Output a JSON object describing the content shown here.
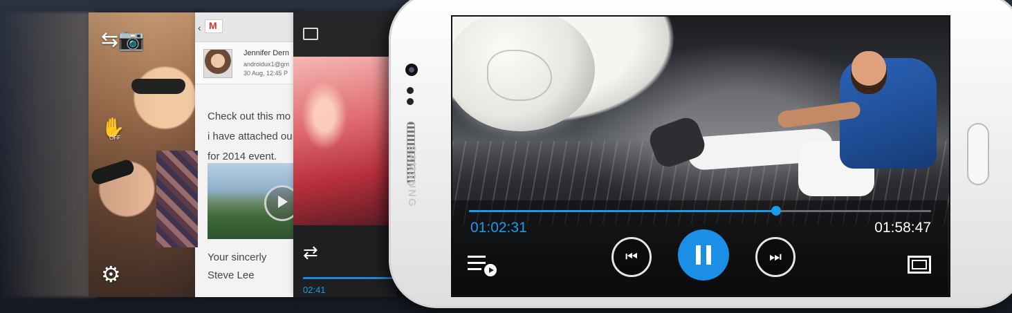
{
  "gallery_panel": {
    "hand_label": "OFF",
    "icons": [
      "camera-switch-icon",
      "hand-off-icon",
      "gear-icon"
    ]
  },
  "email_panel": {
    "sender_name": "Jennifer Dern",
    "sender_address": "androidux1@gm",
    "date": "30 Aug, 12:45 P",
    "body_lines": [
      "Check out this mo",
      "i have attached ou",
      "for 2014 event."
    ],
    "signature_lines": [
      "Your sincerly",
      "Steve Lee"
    ]
  },
  "music_panel": {
    "elapsed": "02:41",
    "icons": [
      "cast-icon",
      "shuffle-icon"
    ]
  },
  "phone": {
    "brand": "SAMSUNG"
  },
  "video_player": {
    "current_time": "01:02:31",
    "total_time": "01:58:47",
    "progress": 0.665,
    "accent_color": "#1a9be8",
    "icons": [
      "previous-icon",
      "pause-icon",
      "next-icon",
      "playlist-icon",
      "fullscreen-icon"
    ]
  }
}
